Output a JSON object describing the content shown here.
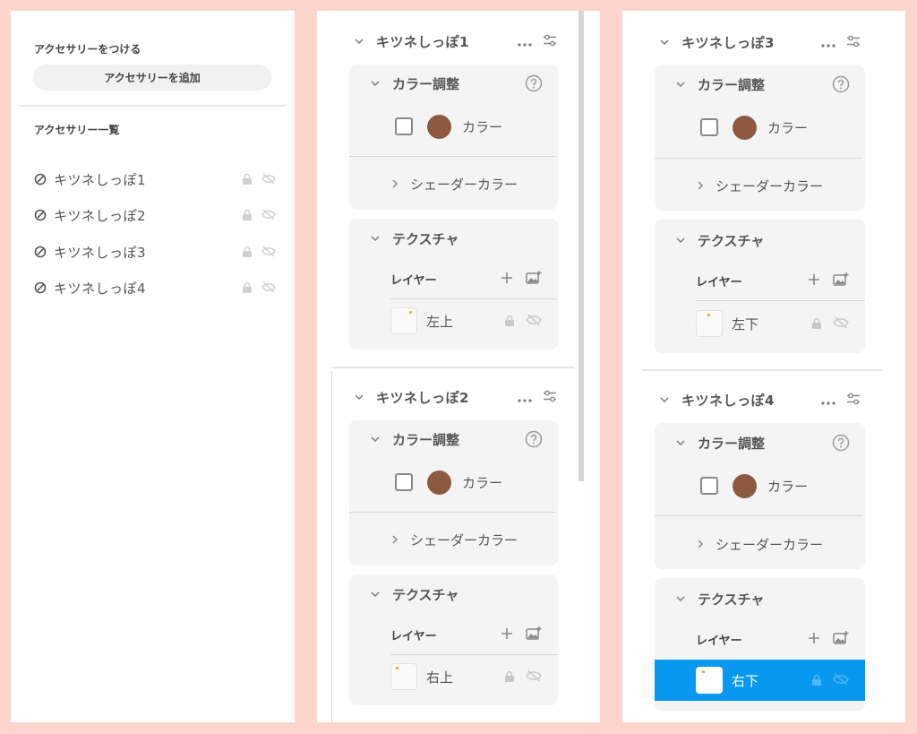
{
  "left_panel": {
    "attach_heading": "アクセサリーをつける",
    "add_button": "アクセサリーを追加",
    "list_heading": "アクセサリー一覧",
    "items": [
      {
        "label": "キツネしっぽ1"
      },
      {
        "label": "キツネしっぽ2"
      },
      {
        "label": "キツネしっぽ3"
      },
      {
        "label": "キツネしっぽ4"
      }
    ]
  },
  "accessories": [
    {
      "title": "キツネしっぽ1",
      "color_adjust": "カラー調整",
      "color_label": "カラー",
      "shader_label": "シェーダーカラー",
      "texture_label": "テクスチャ",
      "layer_header": "レイヤー",
      "layer": {
        "name": "左上",
        "selected": false
      }
    },
    {
      "title": "キツネしっぽ2",
      "color_adjust": "カラー調整",
      "color_label": "カラー",
      "shader_label": "シェーダーカラー",
      "texture_label": "テクスチャ",
      "layer_header": "レイヤー",
      "layer": {
        "name": "右上",
        "selected": false
      }
    },
    {
      "title": "キツネしっぽ3",
      "color_adjust": "カラー調整",
      "color_label": "カラー",
      "shader_label": "シェーダーカラー",
      "texture_label": "テクスチャ",
      "layer_header": "レイヤー",
      "layer": {
        "name": "左下",
        "selected": false
      }
    },
    {
      "title": "キツネしっぽ4",
      "color_adjust": "カラー調整",
      "color_label": "カラー",
      "shader_label": "シェーダーカラー",
      "texture_label": "テクスチャ",
      "layer_header": "レイヤー",
      "layer": {
        "name": "右下",
        "selected": true
      }
    }
  ],
  "colors": {
    "background": "#fdd5cc",
    "swatch": "#8b5a40",
    "selection": "#0898ef"
  },
  "icons": [
    "accessory-icon",
    "lock-icon",
    "eye-off-icon",
    "chevron-down-icon",
    "chevron-right-icon",
    "more-icon",
    "settings-sliders-icon",
    "help-icon",
    "plus-icon",
    "add-image-icon"
  ]
}
